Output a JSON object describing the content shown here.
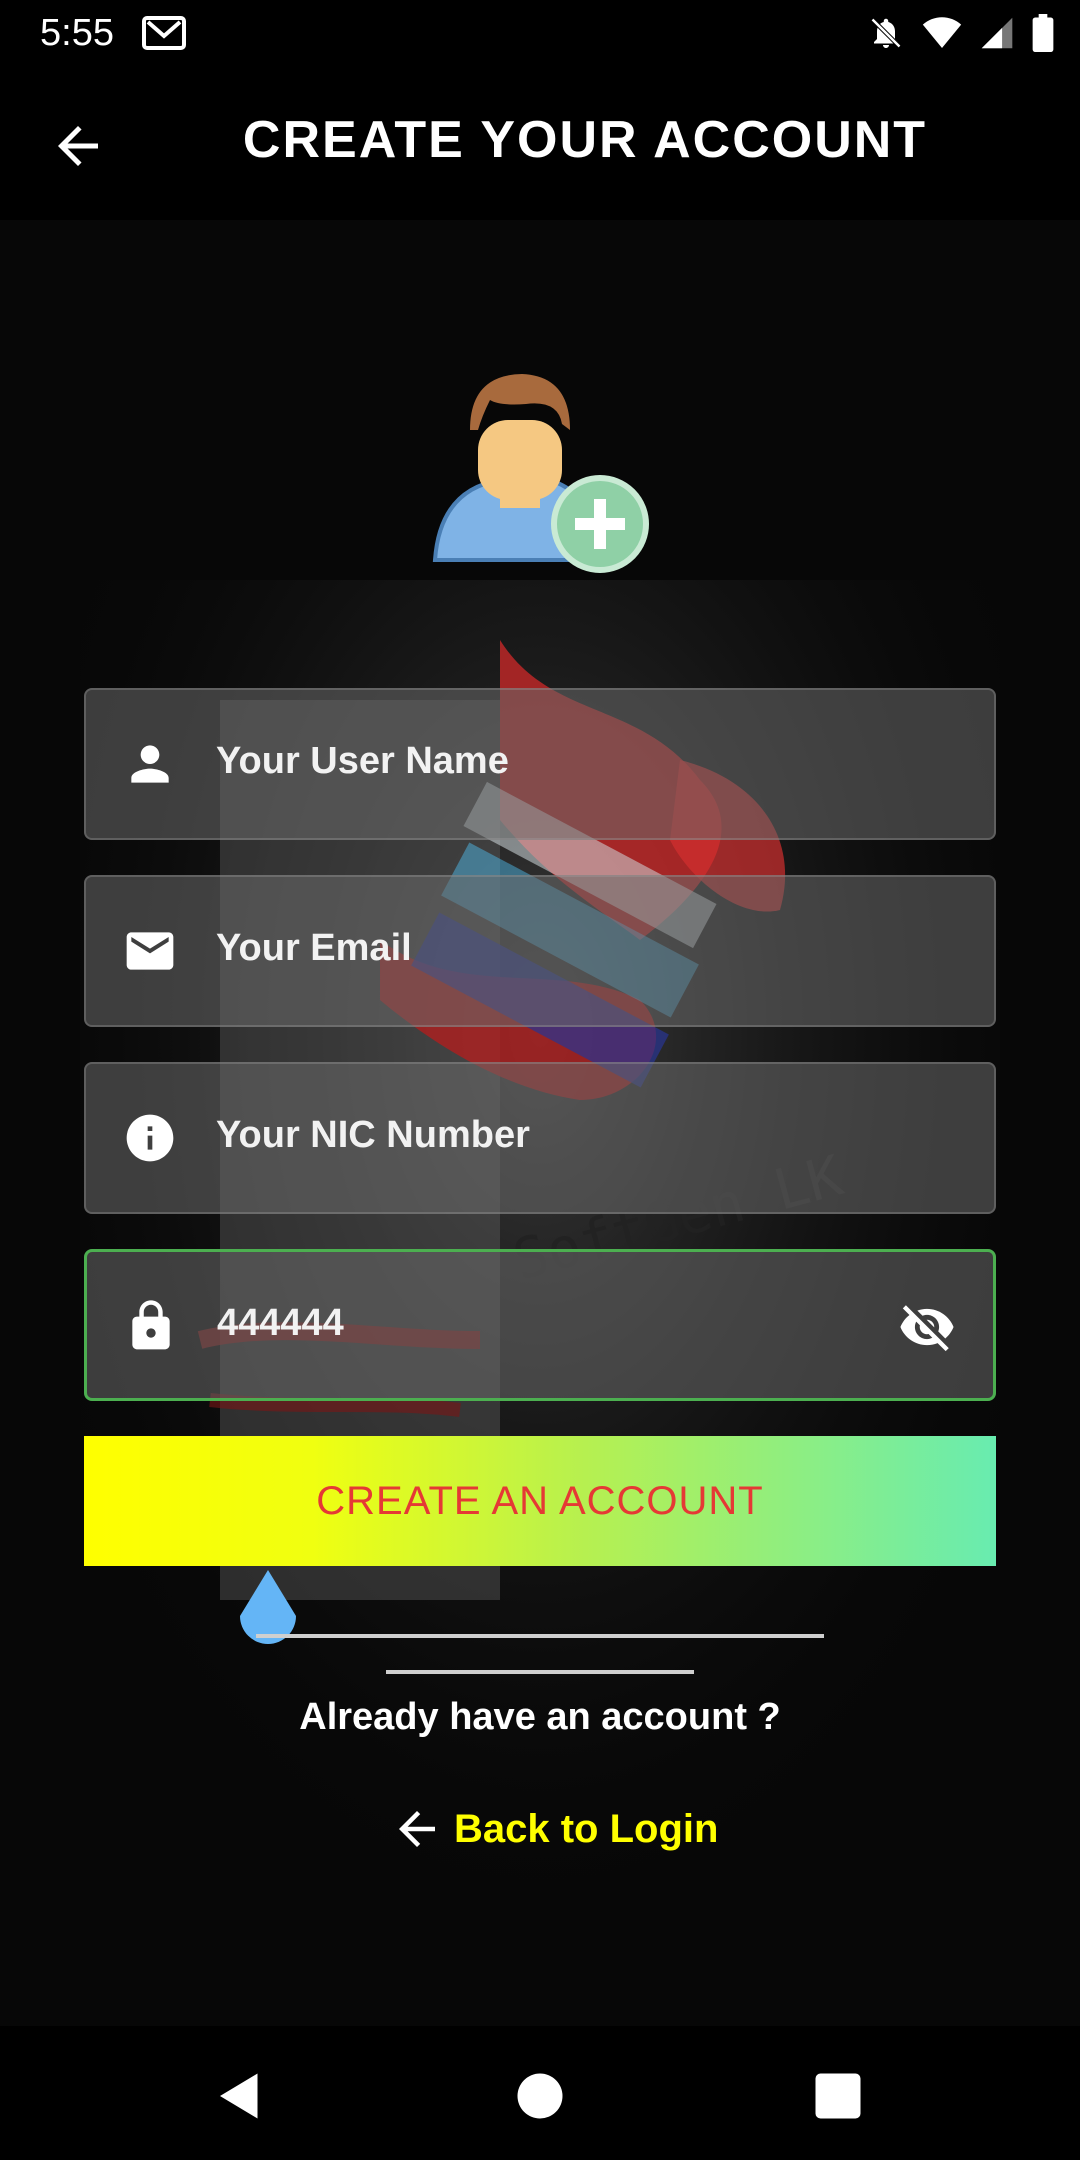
{
  "status_bar": {
    "time": "5:55"
  },
  "app_bar": {
    "title": "CREATE YOUR ACCOUNT"
  },
  "form": {
    "username": {
      "placeholder": "Your User Name"
    },
    "email": {
      "placeholder": "Your Email"
    },
    "nic": {
      "placeholder": "Your NIC Number"
    },
    "password": {
      "value": "444444"
    }
  },
  "actions": {
    "create_label": "CREATE AN ACCOUNT",
    "already_label": "Already have an account ?",
    "back_login_label": "Back to Login"
  },
  "icons": {
    "back": "arrow-left-icon",
    "user": "person-icon",
    "email": "envelope-icon",
    "nic": "info-icon",
    "password": "lock-icon",
    "visibility": "eye-off-icon"
  },
  "colors": {
    "accent_yellow": "#ffff00",
    "button_text": "#e53935",
    "active_border": "#4caf50",
    "gradient_end": "#68ecb0"
  }
}
